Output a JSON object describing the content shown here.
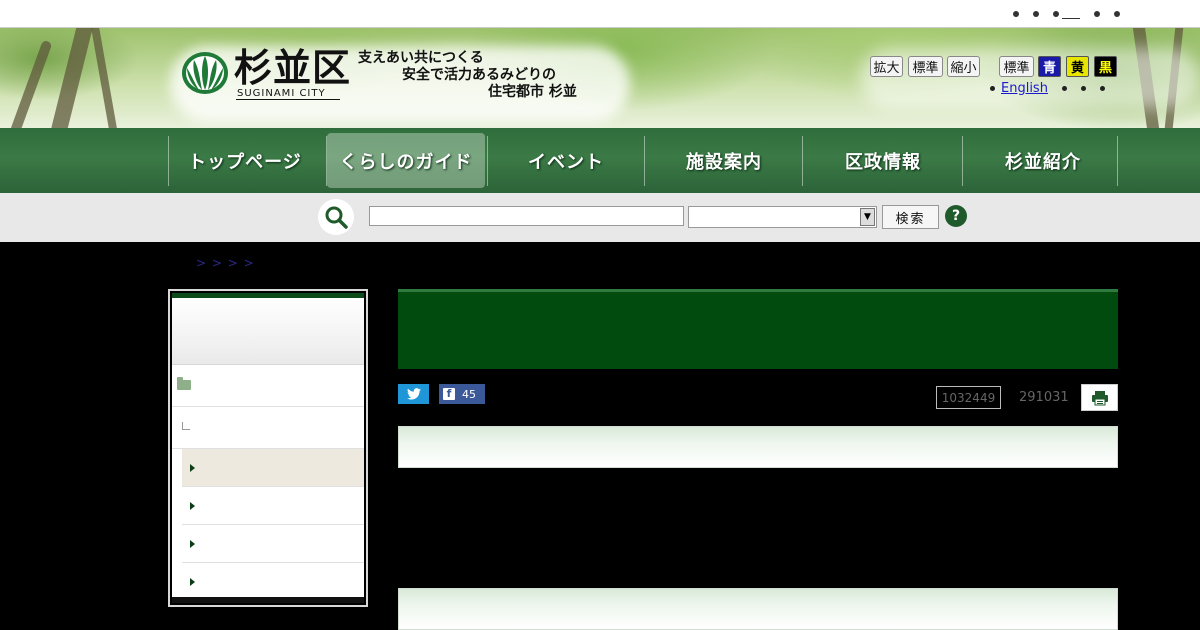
{
  "topbar": {
    "links": [
      "",
      "",
      "",
      "",
      ""
    ]
  },
  "header": {
    "logo_name": "杉並区",
    "logo_sub": "SUGINAMI CITY",
    "tagline": [
      "支えあい共につくる",
      "安全で活力あるみどりの",
      "住宅都市 杉並"
    ],
    "text_size_controls": [
      "拡大",
      "標準",
      "縮小"
    ],
    "color_controls": {
      "standard_label": "標準",
      "options": [
        {
          "label": "青",
          "bg": "#1a1aa8",
          "fg": "#ffffff"
        },
        {
          "label": "黄",
          "bg": "#e6e600",
          "fg": "#000000"
        },
        {
          "label": "黒",
          "bg": "#000000",
          "fg": "#ffff00"
        }
      ]
    },
    "english_link": "English"
  },
  "gnav": {
    "items": [
      {
        "label": "トップページ"
      },
      {
        "label": "くらしのガイド"
      },
      {
        "label": "イベント"
      },
      {
        "label": "施設案内"
      },
      {
        "label": "区政情報"
      },
      {
        "label": "杉並紹介"
      }
    ],
    "active_index": 1
  },
  "search": {
    "input_value": "",
    "select_value": "",
    "button_label": "検索",
    "help_label": "?"
  },
  "breadcrumb": "> > > >",
  "sidebar": {
    "items": [
      "",
      "",
      "",
      "",
      ""
    ]
  },
  "main": {
    "title": "",
    "facebook_count": "45",
    "page_id": "1032449",
    "update_date": "291031"
  },
  "colors": {
    "nav_green": "#2f6e3c",
    "title_green": "#004b0d",
    "twitter_blue": "#1e96d8",
    "facebook_blue": "#3b5998"
  }
}
